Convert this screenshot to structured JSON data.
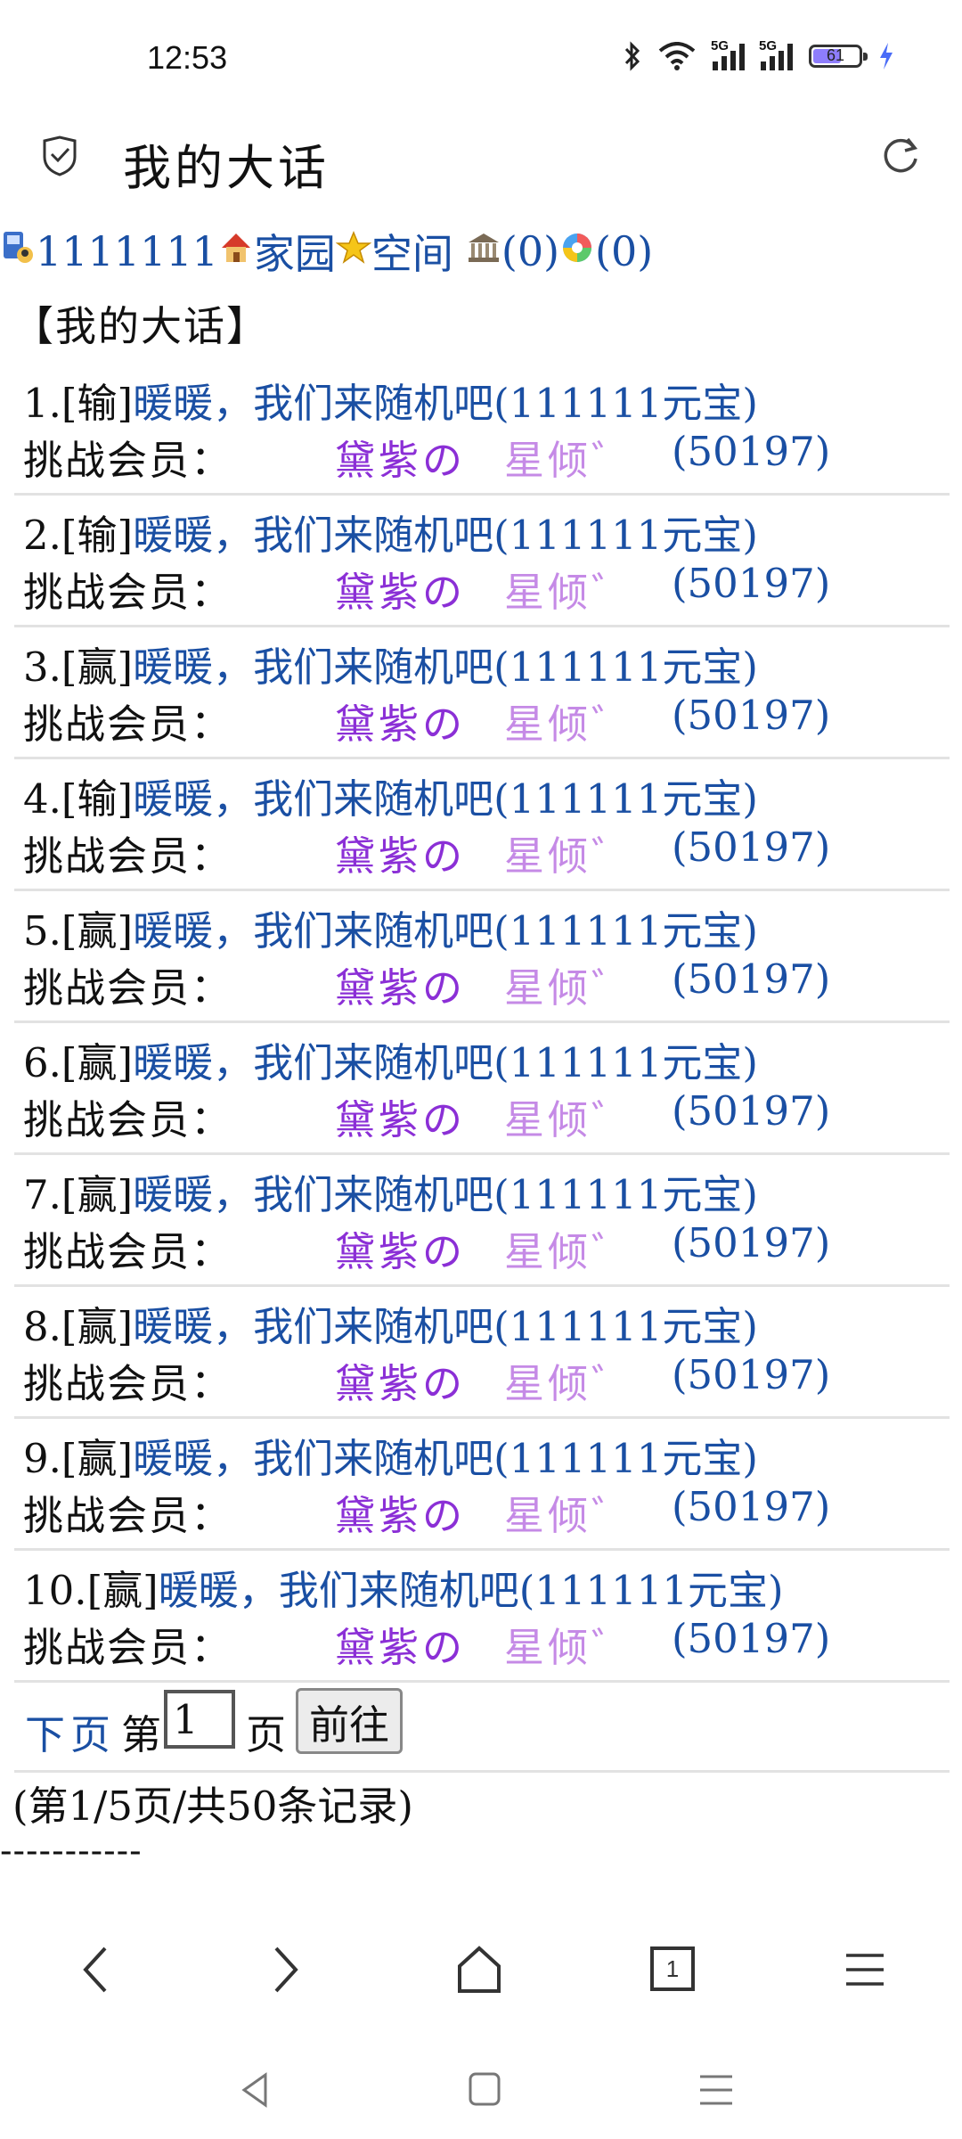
{
  "status_bar": {
    "time": "12:53",
    "battery": "61",
    "network_1": "5G",
    "network_2": "5G"
  },
  "header": {
    "title": "我的大话"
  },
  "nav": {
    "user_id": "1111111",
    "home_label": "家园",
    "space_label": "空间",
    "bank_count": "(0)",
    "color_count": "(0)"
  },
  "section_title": "【我的大话】",
  "items": [
    {
      "prefix": "1.[输]",
      "link": "暖暖，我们来随机吧(111111元宝)",
      "label": "挑战会员：",
      "name_a": "黛紫の",
      "name_b": "星倾゛",
      "score": "(50197)"
    },
    {
      "prefix": "2.[输]",
      "link": "暖暖，我们来随机吧(111111元宝)",
      "label": "挑战会员：",
      "name_a": "黛紫の",
      "name_b": "星倾゛",
      "score": "(50197)"
    },
    {
      "prefix": "3.[赢]",
      "link": "暖暖，我们来随机吧(111111元宝)",
      "label": "挑战会员：",
      "name_a": "黛紫の",
      "name_b": "星倾゛",
      "score": "(50197)"
    },
    {
      "prefix": "4.[输]",
      "link": "暖暖，我们来随机吧(111111元宝)",
      "label": "挑战会员：",
      "name_a": "黛紫の",
      "name_b": "星倾゛",
      "score": "(50197)"
    },
    {
      "prefix": "5.[赢]",
      "link": "暖暖，我们来随机吧(111111元宝)",
      "label": "挑战会员：",
      "name_a": "黛紫の",
      "name_b": "星倾゛",
      "score": "(50197)"
    },
    {
      "prefix": "6.[赢]",
      "link": "暖暖，我们来随机吧(111111元宝)",
      "label": "挑战会员：",
      "name_a": "黛紫の",
      "name_b": "星倾゛",
      "score": "(50197)"
    },
    {
      "prefix": "7.[赢]",
      "link": "暖暖，我们来随机吧(111111元宝)",
      "label": "挑战会员：",
      "name_a": "黛紫の",
      "name_b": "星倾゛",
      "score": "(50197)"
    },
    {
      "prefix": "8.[赢]",
      "link": "暖暖，我们来随机吧(111111元宝)",
      "label": "挑战会员：",
      "name_a": "黛紫の",
      "name_b": "星倾゛",
      "score": "(50197)"
    },
    {
      "prefix": "9.[赢]",
      "link": "暖暖，我们来随机吧(111111元宝)",
      "label": "挑战会员：",
      "name_a": "黛紫の",
      "name_b": "星倾゛",
      "score": "(50197)"
    },
    {
      "prefix": "10.[赢]",
      "link": "暖暖，我们来随机吧(111111元宝)",
      "label": "挑战会员：",
      "name_a": "黛紫の",
      "name_b": "星倾゛",
      "score": "(50197)"
    }
  ],
  "pager": {
    "next_label": "下页",
    "page_prefix": "第",
    "page_value": "1",
    "page_suffix": "页",
    "go_label": "前往"
  },
  "records_text": "(第1/5页/共50条记录)",
  "divider_text": "-----------",
  "toolbar": {
    "tab_count": "1"
  },
  "colors": {
    "link": "#1a4fa3",
    "name_primary": "#8b2fd6",
    "name_secondary": "#c58ae6"
  }
}
